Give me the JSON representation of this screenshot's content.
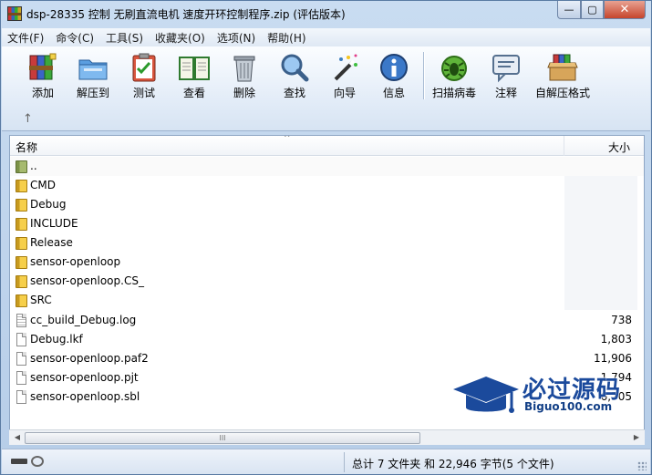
{
  "window": {
    "title": "dsp-28335 控制 无刷直流电机 速度开环控制程序.zip (评估版本)",
    "close_glyph": "✕",
    "min_glyph": "—",
    "max_glyph": "▢"
  },
  "menu": [
    "文件(F)",
    "命令(C)",
    "工具(S)",
    "收藏夹(O)",
    "选项(N)",
    "帮助(H)"
  ],
  "toolbar": {
    "add": "添加",
    "extract": "解压到",
    "test": "测试",
    "view": "查看",
    "delete": "删除",
    "find": "查找",
    "wizard": "向导",
    "info": "信息",
    "scan": "扫描病毒",
    "comment": "注释",
    "sfx": "自解压格式",
    "up_glyph": "↑"
  },
  "list": {
    "col_name": "名称",
    "col_size": "大小",
    "sort_glyph": "^",
    "rows": [
      {
        "name": "..",
        "size": ""
      },
      {
        "name": "CMD",
        "size": ""
      },
      {
        "name": "Debug",
        "size": ""
      },
      {
        "name": "INCLUDE",
        "size": ""
      },
      {
        "name": "Release",
        "size": ""
      },
      {
        "name": "sensor-openloop",
        "size": ""
      },
      {
        "name": "sensor-openloop.CS_",
        "size": ""
      },
      {
        "name": "SRC",
        "size": ""
      },
      {
        "name": "cc_build_Debug.log",
        "size": "738"
      },
      {
        "name": "Debug.lkf",
        "size": "1,803"
      },
      {
        "name": "sensor-openloop.paf2",
        "size": "11,906"
      },
      {
        "name": "sensor-openloop.pjt",
        "size": "1,794"
      },
      {
        "name": "sensor-openloop.sbl",
        "size": "6,705"
      }
    ]
  },
  "scroll": {
    "left": "◀",
    "right": "▶",
    "thumb": "III"
  },
  "status": {
    "summary": "总计 7 文件夹 和 22,946 字节(5 个文件)"
  },
  "watermark": {
    "brand": "必过源码",
    "domain": "Biguo100.com"
  },
  "colors": {
    "accent": "#1b4a9c",
    "close": "#c6452c"
  }
}
